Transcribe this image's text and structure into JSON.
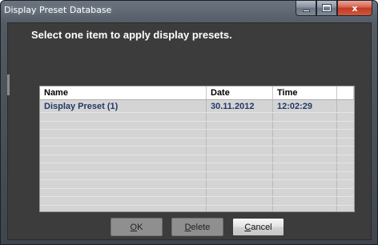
{
  "window": {
    "title": "Display Preset Database",
    "minimize_glyph": "",
    "maximize_glyph": "",
    "close_glyph": "x"
  },
  "instructions": "Select one item to apply display presets.",
  "grid": {
    "columns": [
      "Name",
      "Date",
      "Time"
    ],
    "rows": [
      {
        "name": "Display Preset (1)",
        "date": "30.11.2012",
        "time": "12:02:29"
      }
    ]
  },
  "buttons": {
    "ok": {
      "accel": "O",
      "rest": "K"
    },
    "delete": {
      "accel": "D",
      "rest": "elete"
    },
    "cancel": {
      "accel": "C",
      "rest": "ancel"
    }
  },
  "colors": {
    "client_background": "#3c3c3c",
    "grid_background": "#d4d4d4",
    "close_button": "#c23a22"
  }
}
